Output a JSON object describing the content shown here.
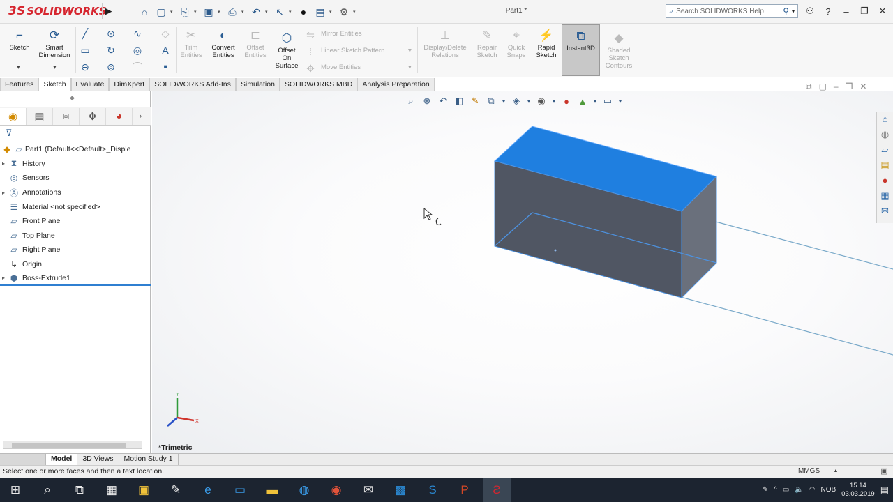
{
  "app": {
    "brand": "SOLIDWORKS",
    "brand_prefix": "3S",
    "document_title": "Part1 *"
  },
  "search": {
    "placeholder": "Search SOLIDWORKS Help"
  },
  "command_manager": {
    "sketch": "Sketch",
    "smart_dimension_1": "Smart",
    "smart_dimension_2": "Dimension",
    "trim_1": "Trim",
    "trim_2": "Entities",
    "convert_1": "Convert",
    "convert_2": "Entities",
    "offset_1": "Offset",
    "offset_2": "Entities",
    "offset_surface_1": "Offset",
    "offset_surface_2": "On",
    "offset_surface_3": "Surface",
    "mirror": "Mirror Entities",
    "linear_pattern": "Linear Sketch Pattern",
    "move": "Move Entities",
    "display_delete_1": "Display/Delete",
    "display_delete_2": "Relations",
    "repair_1": "Repair",
    "repair_2": "Sketch",
    "quick_snaps_1": "Quick",
    "quick_snaps_2": "Snaps",
    "rapid_sketch_1": "Rapid",
    "rapid_sketch_2": "Sketch",
    "instant3d": "Instant3D",
    "shaded_1": "Shaded",
    "shaded_2": "Sketch",
    "shaded_3": "Contours"
  },
  "tabs": [
    "Features",
    "Sketch",
    "Evaluate",
    "DimXpert",
    "SOLIDWORKS Add-Ins",
    "Simulation",
    "SOLIDWORKS MBD",
    "Analysis Preparation"
  ],
  "active_tab": "Sketch",
  "feature_tree": {
    "root": "Part1  (Default<<Default>_Disple",
    "items": [
      {
        "label": "History",
        "icon": "history-icon",
        "expandable": true
      },
      {
        "label": "Sensors",
        "icon": "sensors-icon",
        "expandable": false
      },
      {
        "label": "Annotations",
        "icon": "annotations-icon",
        "expandable": true
      },
      {
        "label": "Material <not specified>",
        "icon": "material-icon",
        "expandable": false
      },
      {
        "label": "Front Plane",
        "icon": "plane-icon",
        "expandable": false
      },
      {
        "label": "Top Plane",
        "icon": "plane-icon",
        "expandable": false
      },
      {
        "label": "Right Plane",
        "icon": "plane-icon",
        "expandable": false
      },
      {
        "label": "Origin",
        "icon": "origin-icon",
        "expandable": false
      },
      {
        "label": "Boss-Extrude1",
        "icon": "extrude-icon",
        "expandable": true
      }
    ]
  },
  "viewport": {
    "view_label": "*Trimetric",
    "triad_x": "X",
    "triad_y": "Y",
    "face_color": "#1f7fe0"
  },
  "bottom_tabs": [
    "Model",
    "3D Views",
    "Motion Study 1"
  ],
  "status": {
    "message": "Select one or more faces and then a text location.",
    "units": "MMGS"
  },
  "taskbar": {
    "lang": "NOB",
    "time": "15.14",
    "date": "03.03.2019"
  }
}
